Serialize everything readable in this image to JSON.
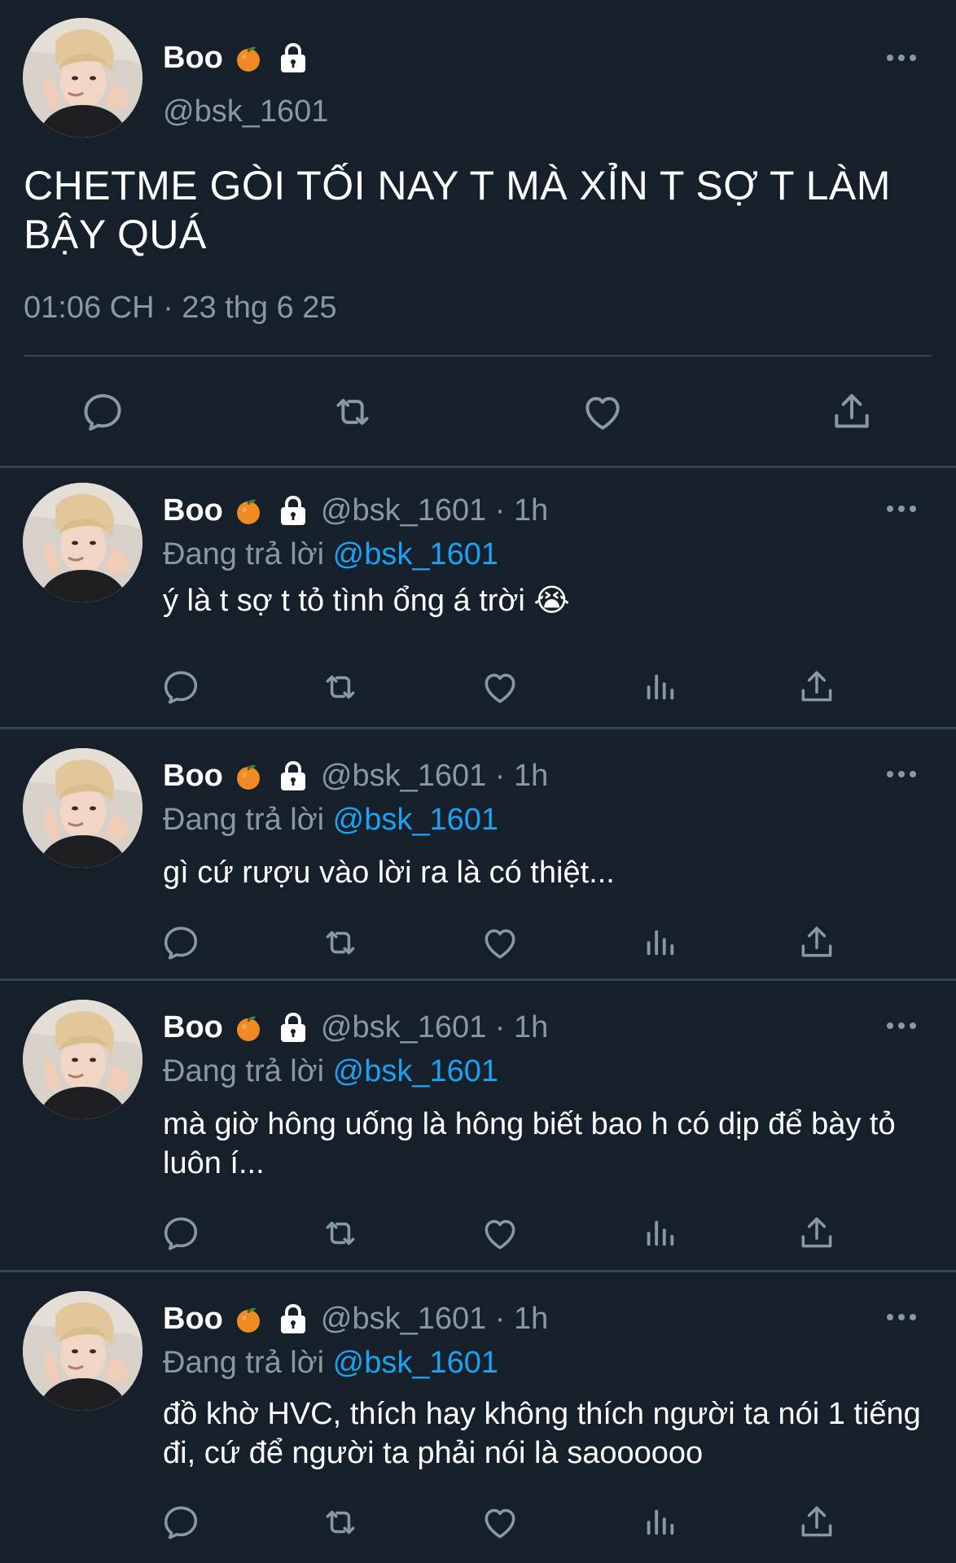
{
  "main_tweet": {
    "display_name": "Boo",
    "handle": "@bsk_1601",
    "text": "CHETME GÒI TỐI NAY T MÀ XỈN T SỢ T LÀM BẬY QUÁ",
    "timestamp": "01:06 CH · 23 thg 6 25"
  },
  "replies": [
    {
      "display_name": "Boo",
      "meta": "@bsk_1601 · 1h",
      "replying_prefix": "Đang trả lời ",
      "replying_to": "@bsk_1601",
      "text": "ý là t sợ t tỏ tình ổng á trời 😭"
    },
    {
      "display_name": "Boo",
      "meta": "@bsk_1601 · 1h",
      "replying_prefix": "Đang trả lời ",
      "replying_to": "@bsk_1601",
      "text": "gì cứ rượu vào lời ra là có thiệt..."
    },
    {
      "display_name": "Boo",
      "meta": "@bsk_1601 · 1h",
      "replying_prefix": "Đang trả lời ",
      "replying_to": "@bsk_1601",
      "text": "mà giờ hông uống là hông biết bao h có dịp để bày tỏ luôn í..."
    },
    {
      "display_name": "Boo",
      "meta": "@bsk_1601 · 1h",
      "replying_prefix": "Đang trả lời ",
      "replying_to": "@bsk_1601",
      "text": "đồ khờ HVC, thích hay không thích người ta nói 1 tiếng đi, cứ để người ta phải nói là saoooooo"
    }
  ],
  "colors": {
    "background": "#15202b",
    "secondary_text": "#8899a6",
    "accent": "#1da1f2",
    "divider": "#38444d"
  },
  "icons": [
    "orange-emoji-icon",
    "lock-icon",
    "more-icon",
    "reply-icon",
    "retweet-icon",
    "like-icon",
    "analytics-icon",
    "share-icon"
  ]
}
